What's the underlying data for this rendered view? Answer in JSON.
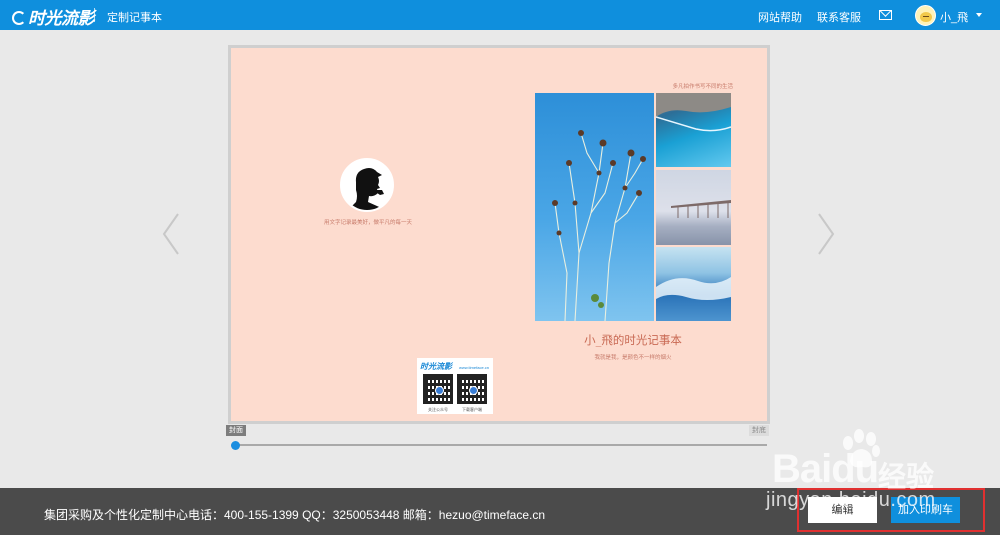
{
  "header": {
    "logo_text": "时光流影",
    "page_name": "定制记事本",
    "nav": {
      "help": "网站帮助",
      "service": "联系客服"
    },
    "mail_icon": "mail-icon",
    "user": {
      "name": "小_飛",
      "avatar_icon": "avatar"
    },
    "colors": {
      "bar": "#0f8fdd",
      "text": "#ffffff"
    }
  },
  "book": {
    "back_cover": {
      "quote": "用文字记录最美好，做平凡的每一天",
      "qr": {
        "logo": "时光流影",
        "url": "www.timeface.cn",
        "caption_left": "关注公众号",
        "caption_right": "下载客户端"
      }
    },
    "front_cover": {
      "small_text": "多凡拍作书写不同的生活",
      "title": "小_飛的时光记事本",
      "subtitle": "我就是我，是颜色不一样的烟火"
    },
    "background": "#fddccf"
  },
  "slider": {
    "start_label": "封面",
    "end_label": "封底",
    "progress": 0
  },
  "footer": {
    "contact_text": "集团采购及个性化定制中心电话：400-155-1399 QQ：3250053448 邮箱：hezuo@timeface.cn",
    "edit_button": "编辑",
    "print_button": "加入印刷车"
  },
  "watermark": {
    "brand": "Bai",
    "brand_tail": "du",
    "cn": "经验",
    "url": "jingyan.baidu.com"
  }
}
